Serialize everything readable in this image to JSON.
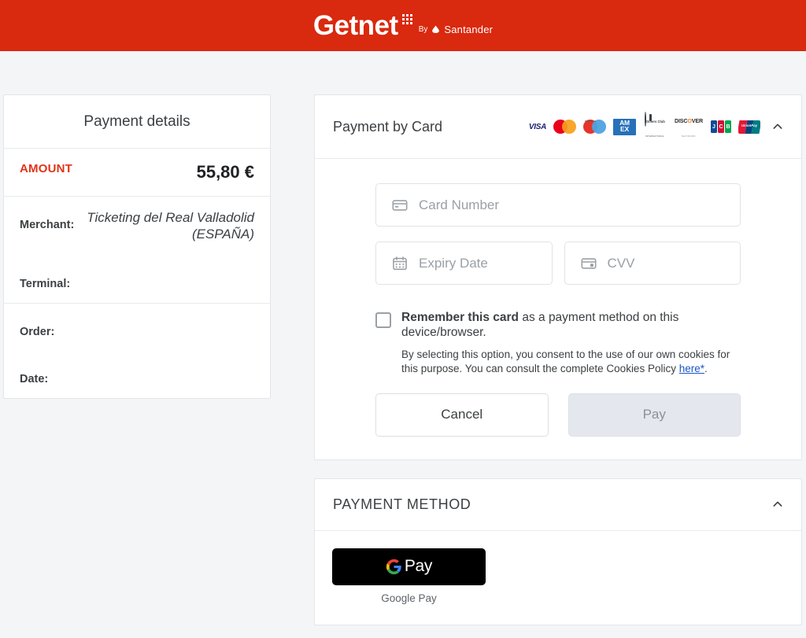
{
  "header": {
    "brand_name": "Getnet",
    "by_label": "By",
    "partner": "Santander",
    "bg_color": "#d9290e"
  },
  "payment_details": {
    "title": "Payment details",
    "amount_label": "AMOUNT",
    "amount_value": "55,80 €",
    "amount_color": "#e13317",
    "rows": [
      {
        "key": "Merchant:",
        "value": "Ticketing del Real Valladolid (ESPAÑA)"
      },
      {
        "key": "Terminal:",
        "value": ""
      },
      {
        "key": "Order:",
        "value": ""
      },
      {
        "key": "Date:",
        "value": ""
      }
    ]
  },
  "card_panel": {
    "title": "Payment by Card",
    "collapse_icon": "chevron-up-icon",
    "brands": [
      {
        "name": "visa",
        "label": "VISA"
      },
      {
        "name": "mastercard",
        "label": ""
      },
      {
        "name": "maestro",
        "label": "maestro"
      },
      {
        "name": "amex",
        "label_top": "AM",
        "label_bottom": "EX"
      },
      {
        "name": "diners-club",
        "label_top": "Diners Club",
        "label_bottom": "INTERNATIONAL"
      },
      {
        "name": "discover",
        "label": "DISC VER",
        "label_sub": "NETWORK"
      },
      {
        "name": "jcb",
        "letters": [
          "J",
          "C",
          "B"
        ]
      },
      {
        "name": "unionpay",
        "label": "UnionPay"
      }
    ],
    "fields": {
      "card_number_placeholder": "Card Number",
      "expiry_placeholder": "Expiry Date",
      "cvv_placeholder": "CVV"
    },
    "remember": {
      "strong": "Remember this card",
      "rest": " as a payment method on this device/browser.",
      "consent_before": "By selecting this option, you consent to the use of our own cookies for this purpose. You can consult the complete Cookies Policy ",
      "link": "here*",
      "consent_after": "."
    },
    "buttons": {
      "cancel": "Cancel",
      "pay": "Pay"
    }
  },
  "payment_method": {
    "title": "PAYMENT METHOD",
    "collapse_icon": "chevron-up-icon",
    "gpay_text": "Pay",
    "gpay_caption": "Google Pay"
  }
}
